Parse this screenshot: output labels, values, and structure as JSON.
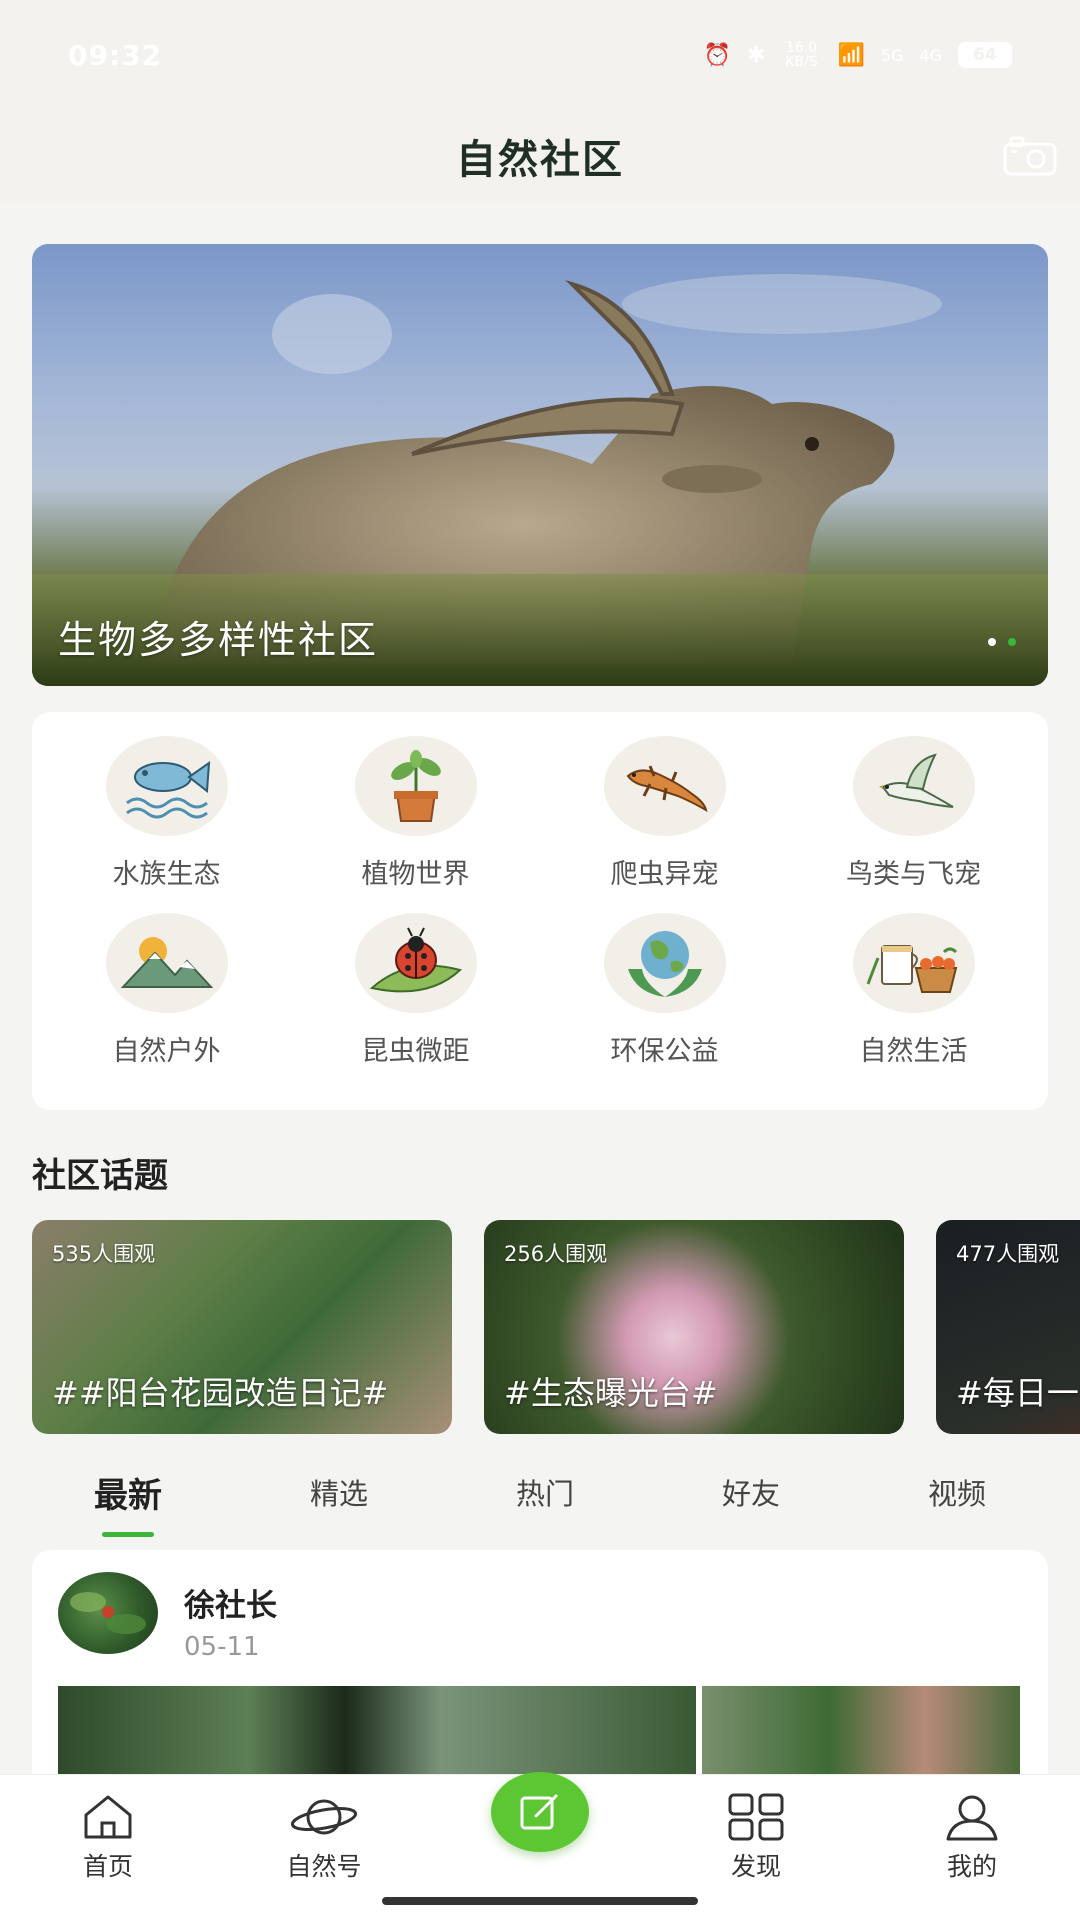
{
  "status_bar": {
    "time": "09:32",
    "network_speed": "16.0 KB/S",
    "signal_1": "5G",
    "signal_2": "4G",
    "battery": "64"
  },
  "header": {
    "title": "自然社区",
    "camera_icon": "camera-icon"
  },
  "banner": {
    "title": "生物多多样性社区",
    "dot_count": 2,
    "active_dot": 2
  },
  "categories": [
    {
      "label": "水族生态",
      "icon": "fish-icon"
    },
    {
      "label": "植物世界",
      "icon": "potted-plant-icon"
    },
    {
      "label": "爬虫异宠",
      "icon": "lizard-icon"
    },
    {
      "label": "鸟类与飞宠",
      "icon": "bird-icon"
    },
    {
      "label": "自然户外",
      "icon": "mountain-icon"
    },
    {
      "label": "昆虫微距",
      "icon": "ladybug-icon"
    },
    {
      "label": "环保公益",
      "icon": "earth-hands-icon"
    },
    {
      "label": "自然生活",
      "icon": "tea-basket-icon"
    }
  ],
  "community_topics": {
    "title": "社区话题",
    "items": [
      {
        "views": "535人围观",
        "title": "##阳台花园改造日记#"
      },
      {
        "views": "256人围观",
        "title": "#生态曝光台#"
      },
      {
        "views": "477人围观",
        "title": "#每日一"
      }
    ]
  },
  "feed_tabs": [
    {
      "label": "最新",
      "active": true
    },
    {
      "label": "精选",
      "active": false
    },
    {
      "label": "热门",
      "active": false
    },
    {
      "label": "好友",
      "active": false
    },
    {
      "label": "视频",
      "active": false
    }
  ],
  "post": {
    "author": "徐社长",
    "date": "05-11"
  },
  "bottom_nav": [
    {
      "label": "首页",
      "icon": "home-icon"
    },
    {
      "label": "自然号",
      "icon": "planet-icon"
    },
    {
      "label": "",
      "icon": "edit-icon"
    },
    {
      "label": "发现",
      "icon": "grid-icon"
    },
    {
      "label": "我的",
      "icon": "user-icon"
    }
  ],
  "colors": {
    "accent": "#5cc733",
    "tab_underline": "#3db53a",
    "header_bg": "#f3f2ee",
    "page_bg": "#f4f4f2"
  }
}
